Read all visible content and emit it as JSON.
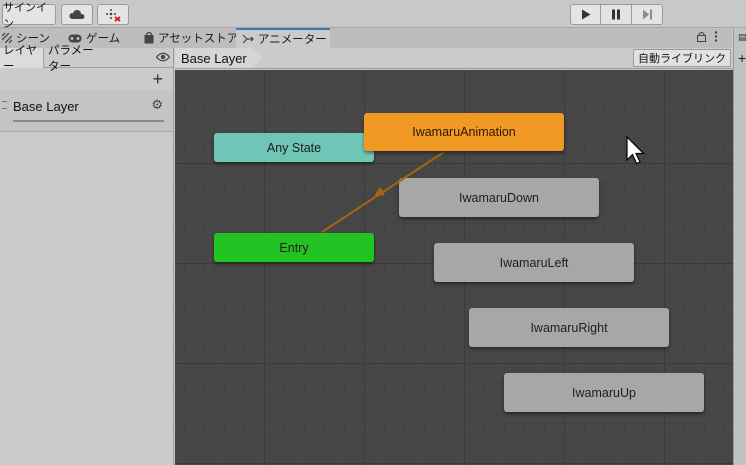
{
  "toolbar": {
    "signin_label": "サインイン",
    "cloud_icon": "cloud-icon",
    "collab_icon": "collab-icon",
    "play_icon": "play-icon",
    "pause_icon": "pause-icon",
    "step_icon": "step-icon"
  },
  "tabs": [
    {
      "label": "シーン",
      "icon": "scene-icon"
    },
    {
      "label": "ゲーム",
      "icon": "game-controller-icon"
    },
    {
      "label": "アセットストア",
      "icon": "shopping-bag-icon"
    },
    {
      "label": "アニメーター",
      "icon": "animator-icon"
    }
  ],
  "left_panel": {
    "tabs": [
      {
        "label": "レイヤー"
      },
      {
        "label": "パラメーター"
      }
    ],
    "layer": {
      "name": "Base Layer"
    }
  },
  "breadcrumb": {
    "label": "Base Layer"
  },
  "auto_live_link_label": "自動ライブリンク",
  "graph": {
    "states": {
      "any_state": "Any State",
      "entry": "Entry",
      "default": "IwamaruAnimation",
      "down": "IwamaruDown",
      "left": "IwamaruLeft",
      "right": "IwamaruRight",
      "up": "IwamaruUp"
    },
    "colors": {
      "any_state": "#6fc6b6",
      "entry": "#22c322",
      "default": "#f09a23",
      "state": "#a7a7a7",
      "transition": "#a8640a"
    }
  }
}
